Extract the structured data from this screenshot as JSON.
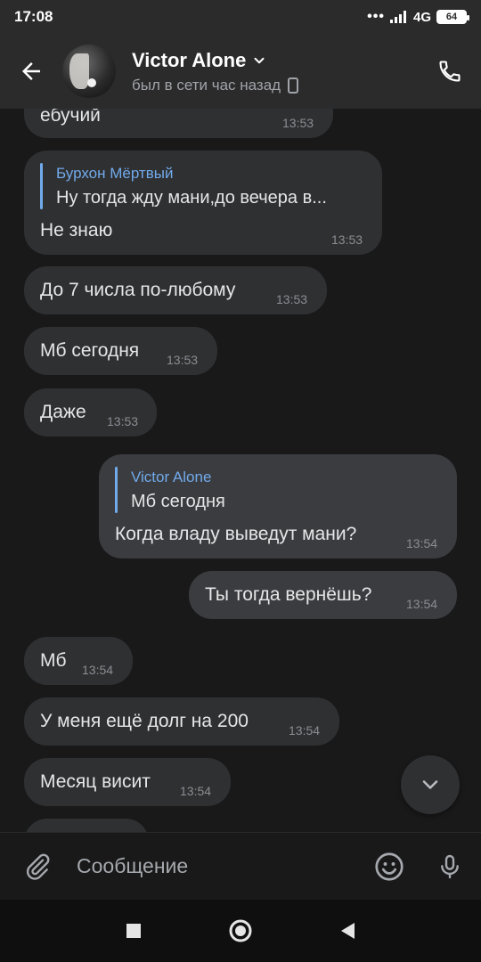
{
  "status_bar": {
    "time": "17:08",
    "signal_dots": "•••",
    "network": "4G",
    "battery": "64"
  },
  "header": {
    "name": "Victor Alone",
    "status": "был в сети час назад",
    "back_icon": "arrow-left-icon",
    "phone_icon": "phone-icon",
    "device_icon": "mobile-device-icon"
  },
  "messages": [
    {
      "text": "ебучий",
      "time": "13:53"
    },
    {
      "reply_author": "Бурхон Мёртвый",
      "reply_text": "Ну тогда жду мани,до  вечера в...",
      "text": "Не знаю",
      "time": "13:53"
    },
    {
      "text": "До 7 числа по-любому",
      "time": "13:53"
    },
    {
      "text": "Мб сегодня",
      "time": "13:53"
    },
    {
      "text": "Даже",
      "time": "13:53"
    },
    {
      "reply_author": "Victor Alone",
      "reply_text": "Мб сегодня",
      "text": "Когда владу выведут мани?",
      "time": "13:54"
    },
    {
      "text": "Ты тогда вернёшь?",
      "time": "13:54"
    },
    {
      "text": "Мб",
      "time": "13:54"
    },
    {
      "text": "У меня ещё долг на 200",
      "time": "13:54"
    },
    {
      "text": "Месяц висит",
      "time": "13:54"
    }
  ],
  "composer": {
    "placeholder": "Сообщение",
    "attach_icon": "paperclip-icon",
    "emoji_icon": "smiley-icon",
    "mic_icon": "microphone-icon"
  },
  "colors": {
    "background": "#19191a",
    "header": "#2b2b2c",
    "bubble_in": "#2f3032",
    "bubble_out": "#3b3c3f",
    "accent": "#71aaeb"
  }
}
